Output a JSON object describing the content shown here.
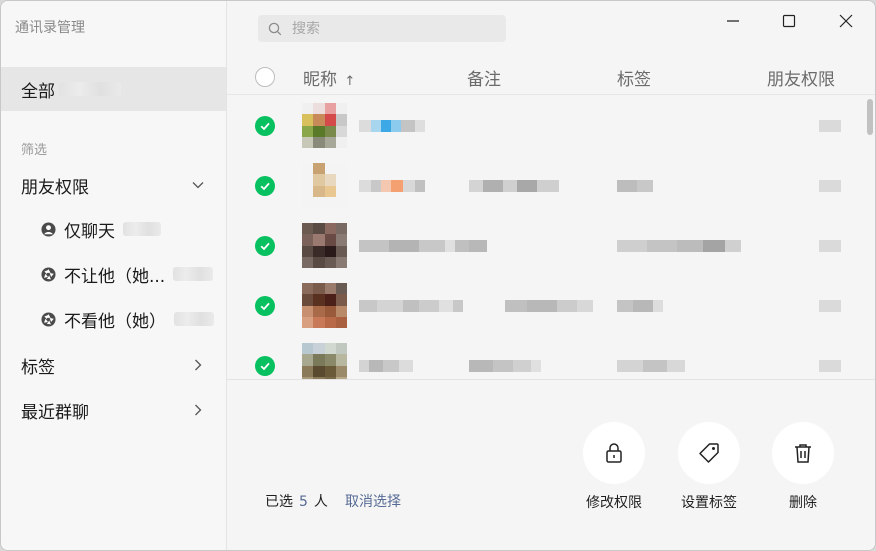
{
  "app": {
    "title": "通讯录管理"
  },
  "sidebar": {
    "all_label": "全部",
    "filter_section": "筛选",
    "friend_perm_label": "朋友权限",
    "sub_items": [
      {
        "label": "仅聊天",
        "icon": "person-icon"
      },
      {
        "label": "不让他（她...",
        "icon": "aperture-icon"
      },
      {
        "label": "不看他（她）",
        "icon": "aperture-icon"
      }
    ],
    "tags_label": "标签",
    "recent_groups_label": "最近群聊"
  },
  "search": {
    "placeholder": "搜索"
  },
  "table": {
    "columns": {
      "nickname": "昵称",
      "sort_indicator": "↑",
      "remark": "备注",
      "tag": "标签",
      "friend_perm": "朋友权限"
    },
    "rows": [
      {
        "selected": true
      },
      {
        "selected": true
      },
      {
        "selected": true
      },
      {
        "selected": true
      },
      {
        "selected": true
      }
    ]
  },
  "footer": {
    "selected_prefix": "已选",
    "selected_count": "5",
    "selected_suffix": "人",
    "cancel_label": "取消选择",
    "actions": [
      {
        "label": "修改权限",
        "icon": "lock-icon"
      },
      {
        "label": "设置标签",
        "icon": "tag-icon"
      },
      {
        "label": "删除",
        "icon": "trash-icon"
      }
    ]
  },
  "colors": {
    "accent_green": "#07c160",
    "link_blue": "#576b95",
    "sidebar_bg": "#f7f7f7",
    "selected_bg": "#e6e6e6"
  }
}
